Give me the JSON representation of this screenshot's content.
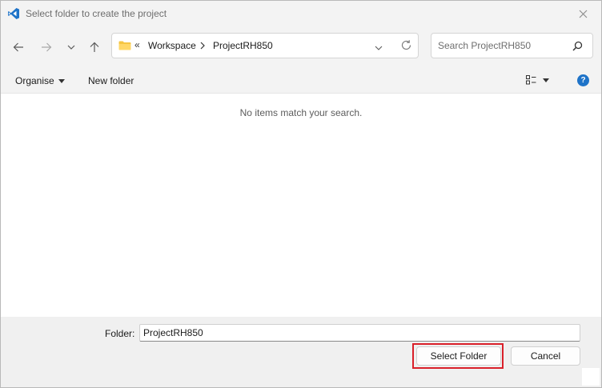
{
  "titlebar": {
    "title": "Select folder to create the project",
    "app_icon": "vscode-icon",
    "close_icon": "close-icon",
    "accent": "#1e73c8"
  },
  "navigation": {
    "back_icon": "arrow-left-icon",
    "forward_icon": "arrow-right-icon",
    "recent_icon": "chevron-down-icon",
    "up_icon": "arrow-up-icon"
  },
  "address": {
    "overflow": "«",
    "crumbs": [
      "Workspace",
      "ProjectRH850"
    ],
    "folder_icon": "folder-icon",
    "refresh_icon": "refresh-icon"
  },
  "search": {
    "placeholder": "Search ProjectRH850",
    "icon": "search-icon"
  },
  "commands": {
    "organise": "Organise",
    "new_folder": "New folder",
    "view_icon": "view-options-icon",
    "help_label": "?"
  },
  "content": {
    "empty_message": "No items match your search."
  },
  "footer": {
    "folder_label": "Folder:",
    "folder_value": "ProjectRH850",
    "select_button": "Select Folder",
    "cancel_button": "Cancel",
    "highlight_color": "#d9202a"
  }
}
